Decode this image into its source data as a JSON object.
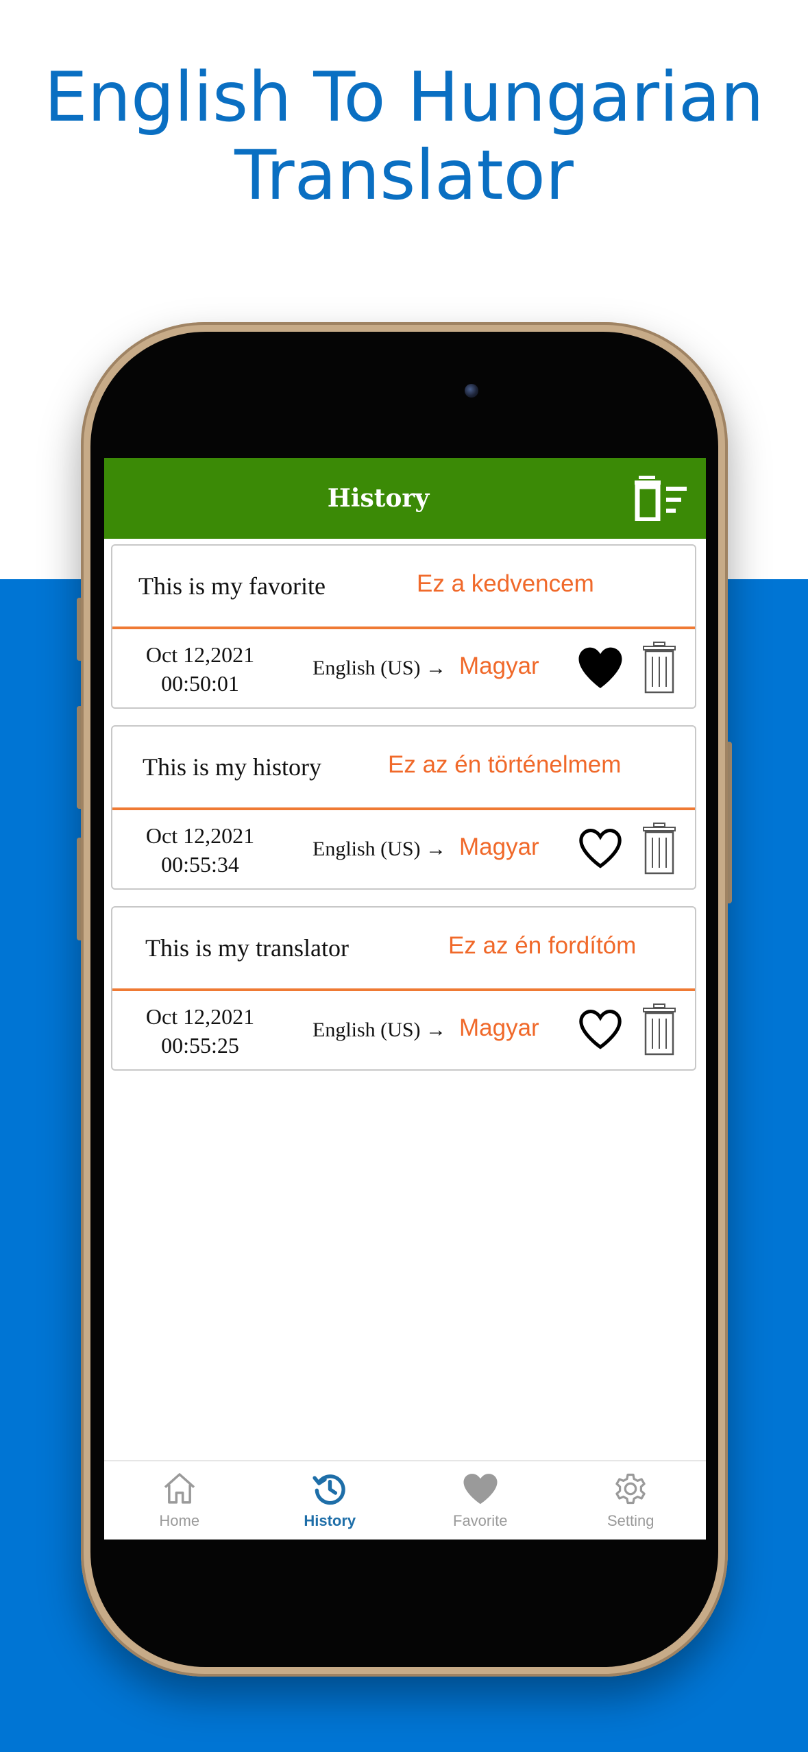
{
  "headline": {
    "line1": "English To Hungarian",
    "line2": "Translator"
  },
  "appbar": {
    "title": "History",
    "clear_icon": "clear-all-icon"
  },
  "history": [
    {
      "source": "This is my favorite",
      "target": "Ez a kedvencem",
      "date": "Oct 12,2021",
      "time": "00:50:01",
      "from_lang": "English (US) →",
      "to_lang": "Magyar",
      "favorite": true
    },
    {
      "source": "This is my history",
      "target": "Ez az én történelmem",
      "date": "Oct 12,2021",
      "time": "00:55:34",
      "from_lang": "English (US) →",
      "to_lang": "Magyar",
      "favorite": false
    },
    {
      "source": "This is my translator",
      "target": "Ez az én fordítóm",
      "date": "Oct 12,2021",
      "time": "00:55:25",
      "from_lang": "English (US) →",
      "to_lang": "Magyar",
      "favorite": false
    }
  ],
  "tabs": [
    {
      "label": "Home",
      "icon": "home-icon",
      "active": false
    },
    {
      "label": "History",
      "icon": "history-icon",
      "active": true
    },
    {
      "label": "Favorite",
      "icon": "heart-icon",
      "active": false
    },
    {
      "label": "Setting",
      "icon": "gear-icon",
      "active": false
    }
  ],
  "colors": {
    "brand_blue": "#0075d4",
    "headline_blue": "#0a6fc2",
    "appbar_green": "#3b8a06",
    "accent_orange": "#f0692a",
    "tab_active": "#1e6ea8",
    "tab_inactive": "#9a9a9a"
  }
}
